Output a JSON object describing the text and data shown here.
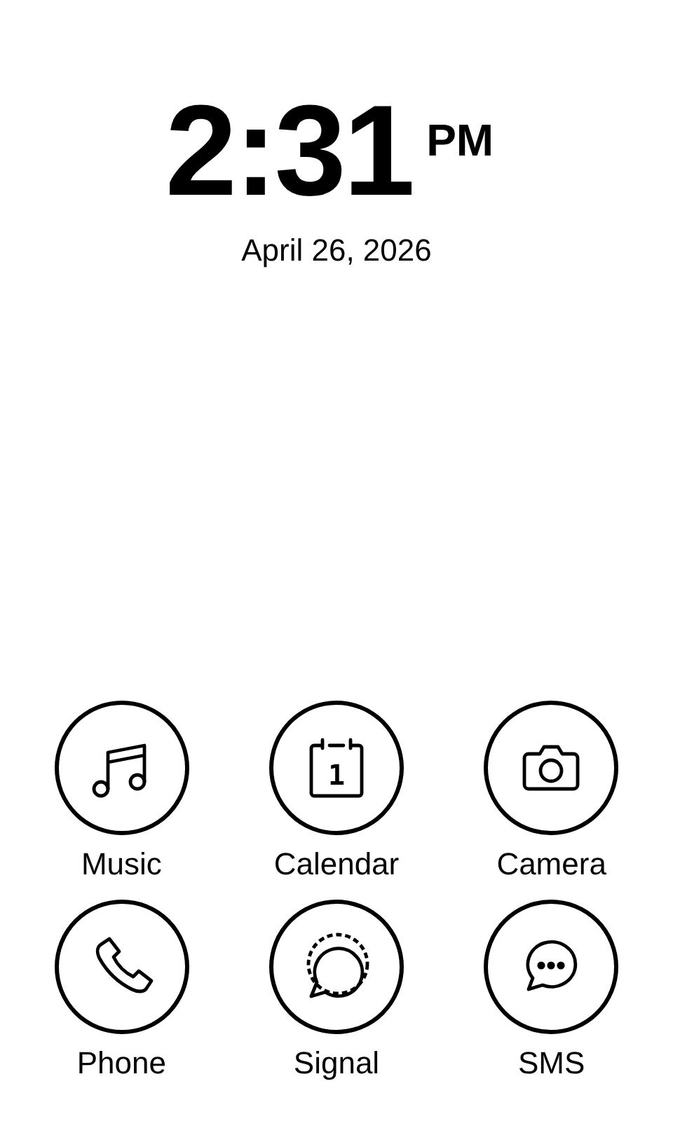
{
  "clock": {
    "time": "2:31",
    "period": "PM",
    "date": "April 26, 2026"
  },
  "apps": [
    {
      "kind": "music",
      "label": "Music"
    },
    {
      "kind": "calendar",
      "label": "Calendar",
      "icon_text": "1"
    },
    {
      "kind": "camera",
      "label": "Camera"
    },
    {
      "kind": "phone",
      "label": "Phone"
    },
    {
      "kind": "signal",
      "label": "Signal"
    },
    {
      "kind": "sms",
      "label": "SMS"
    }
  ]
}
